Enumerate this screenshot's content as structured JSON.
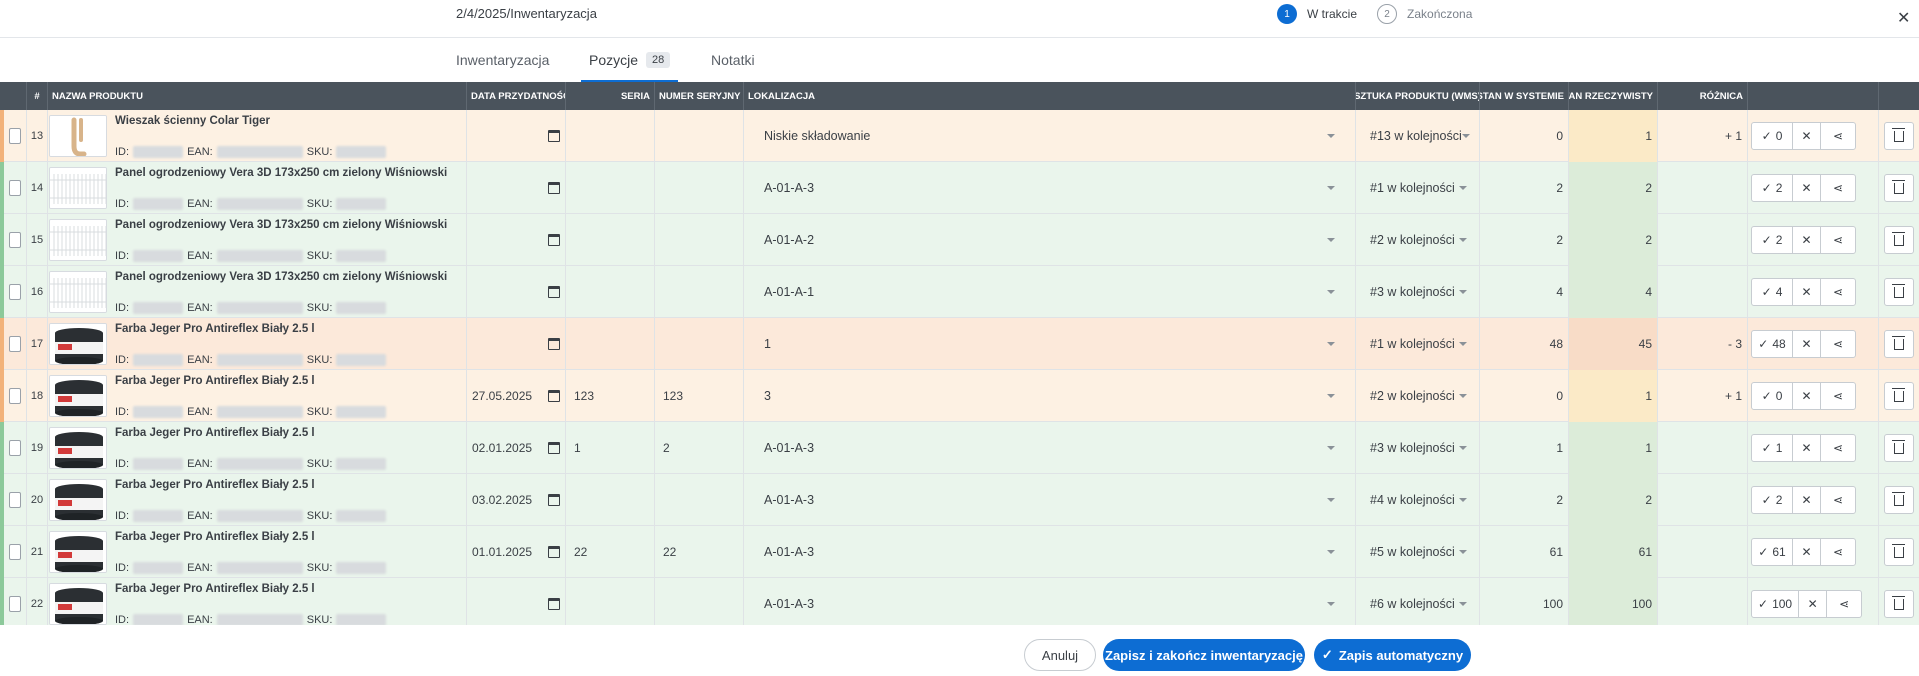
{
  "header": {
    "breadcrumb": "2/4/2025/Inwentaryzacja",
    "steps": [
      {
        "number": "1",
        "label": "W trakcie",
        "state": "active"
      },
      {
        "number": "2",
        "label": "Zakończona",
        "state": "inactive"
      }
    ],
    "close_icon": "close-icon"
  },
  "tabs": [
    {
      "label": "Inwentaryzacja",
      "badge": ""
    },
    {
      "label": "Pozycje",
      "badge": "28"
    },
    {
      "label": "Notatki",
      "badge": ""
    }
  ],
  "columns": {
    "num": "#",
    "product": "NAZWA PRODUKTU",
    "expiry": "DATA PRZYDATNOŚCI",
    "series": "SERIA",
    "serial": "NUMER SERYJNY",
    "location": "LOKALIZACJA",
    "unit": "SZTUKA PRODUKTU (WMS)",
    "system_stock": "STAN W SYSTEMIE",
    "actual_stock": "STAN RZECZYWISTY",
    "difference": "RÓŻNICA"
  },
  "meta_labels": {
    "id": "ID:",
    "ean": "EAN:",
    "sku": "SKU:"
  },
  "rows": [
    {
      "num": "13",
      "name": "Wieszak ścienny Colar Tiger",
      "thumb": "hook",
      "expiry": "",
      "series": "",
      "serial": "",
      "location": "Niskie składowanie",
      "unit": "#13 w kolejności",
      "system": "0",
      "actual": "1",
      "diff": "+ 1",
      "confirm": "0",
      "status": "orange"
    },
    {
      "num": "14",
      "name": "Panel ogrodzeniowy Vera 3D 173x250 cm zielony Wiśniowski",
      "thumb": "panel",
      "expiry": "",
      "series": "",
      "serial": "",
      "location": "A-01-A-3",
      "unit": "#1 w kolejności",
      "system": "2",
      "actual": "2",
      "diff": "",
      "confirm": "2",
      "status": "green"
    },
    {
      "num": "15",
      "name": "Panel ogrodzeniowy Vera 3D 173x250 cm zielony Wiśniowski",
      "thumb": "panel",
      "expiry": "",
      "series": "",
      "serial": "",
      "location": "A-01-A-2",
      "unit": "#2 w kolejności",
      "system": "2",
      "actual": "2",
      "diff": "",
      "confirm": "2",
      "status": "green"
    },
    {
      "num": "16",
      "name": "Panel ogrodzeniowy Vera 3D 173x250 cm zielony Wiśniowski",
      "thumb": "panel",
      "expiry": "",
      "series": "",
      "serial": "",
      "location": "A-01-A-1",
      "unit": "#3 w kolejności",
      "system": "4",
      "actual": "4",
      "diff": "",
      "confirm": "4",
      "status": "green"
    },
    {
      "num": "17",
      "name": "Farba Jeger Pro Antireflex Biały 2.5 l",
      "thumb": "paint",
      "expiry": "",
      "series": "",
      "serial": "",
      "location": "1",
      "unit": "#1 w kolejności",
      "system": "48",
      "actual": "45",
      "diff": "- 3",
      "confirm": "48",
      "status": "orange2"
    },
    {
      "num": "18",
      "name": "Farba Jeger Pro Antireflex Biały 2.5 l",
      "thumb": "paint",
      "expiry": "27.05.2025",
      "series": "123",
      "serial": "123",
      "location": "3",
      "unit": "#2 w kolejności",
      "system": "0",
      "actual": "1",
      "diff": "+ 1",
      "confirm": "0",
      "status": "orange"
    },
    {
      "num": "19",
      "name": "Farba Jeger Pro Antireflex Biały 2.5 l",
      "thumb": "paint",
      "expiry": "02.01.2025",
      "series": "1",
      "serial": "2",
      "location": "A-01-A-3",
      "unit": "#3 w kolejności",
      "system": "1",
      "actual": "1",
      "diff": "",
      "confirm": "1",
      "status": "green"
    },
    {
      "num": "20",
      "name": "Farba Jeger Pro Antireflex Biały 2.5 l",
      "thumb": "paint",
      "expiry": "03.02.2025",
      "series": "",
      "serial": "",
      "location": "A-01-A-3",
      "unit": "#4 w kolejności",
      "system": "2",
      "actual": "2",
      "diff": "",
      "confirm": "2",
      "status": "green"
    },
    {
      "num": "21",
      "name": "Farba Jeger Pro Antireflex Biały 2.5 l",
      "thumb": "paint",
      "expiry": "01.01.2025",
      "series": "22",
      "serial": "22",
      "location": "A-01-A-3",
      "unit": "#5 w kolejności",
      "system": "61",
      "actual": "61",
      "diff": "",
      "confirm": "61",
      "status": "green"
    },
    {
      "num": "22",
      "name": "Farba Jeger Pro Antireflex Biały 2.5 l",
      "thumb": "paint",
      "expiry": "",
      "series": "",
      "serial": "",
      "location": "A-01-A-3",
      "unit": "#6 w kolejności",
      "system": "100",
      "actual": "100",
      "diff": "",
      "confirm": "100",
      "status": "green"
    }
  ],
  "footer": {
    "cancel": "Anuluj",
    "save_finish": "Zapisz i zakończ inwentaryzację",
    "autosave": "Zapis automatyczny"
  },
  "colors": {
    "primary": "#0d6dd3",
    "header_bg": "#4a535c",
    "row_green": "#eaf5ec",
    "row_orange": "#fdf1e3"
  }
}
